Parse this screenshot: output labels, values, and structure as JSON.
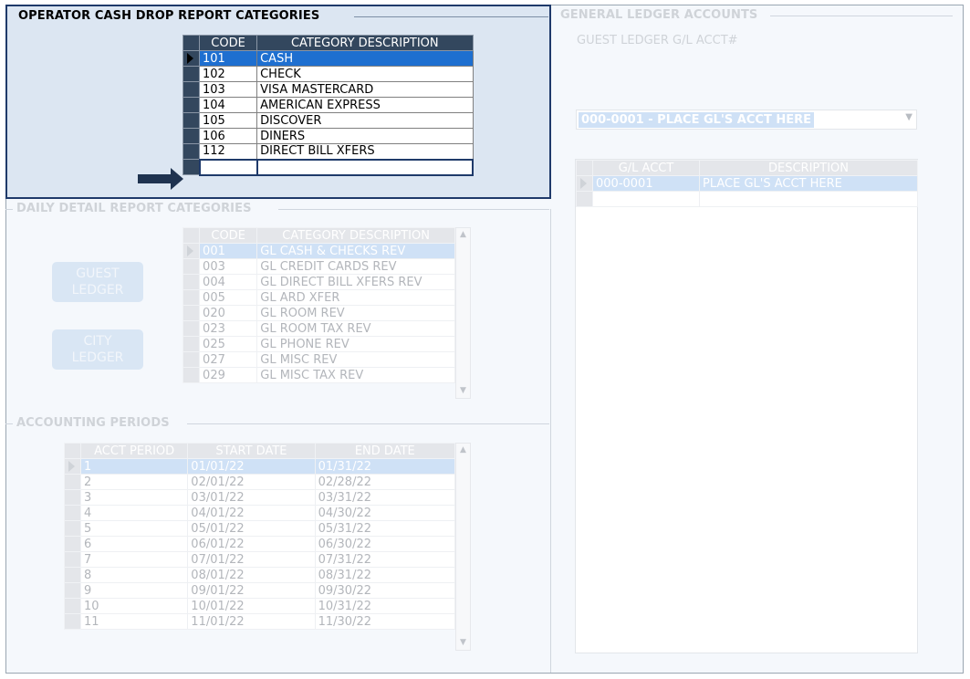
{
  "operator_panel": {
    "title": "OPERATOR CASH DROP REPORT CATEGORIES",
    "columns": [
      "CODE",
      "CATEGORY DESCRIPTION"
    ],
    "rows": [
      {
        "code": "101",
        "desc": "CASH",
        "selected": true
      },
      {
        "code": "102",
        "desc": "CHECK"
      },
      {
        "code": "103",
        "desc": "VISA MASTERCARD"
      },
      {
        "code": "104",
        "desc": "AMERICAN EXPRESS"
      },
      {
        "code": "105",
        "desc": "DISCOVER"
      },
      {
        "code": "106",
        "desc": "DINERS"
      },
      {
        "code": "112",
        "desc": "DIRECT BILL XFERS"
      }
    ]
  },
  "daily_panel": {
    "title": "DAILY DETAIL REPORT CATEGORIES",
    "columns": [
      "CODE",
      "CATEGORY DESCRIPTION"
    ],
    "rows": [
      {
        "code": "001",
        "desc": "GL CASH & CHECKS REV",
        "selected": true
      },
      {
        "code": "003",
        "desc": "GL CREDIT CARDS REV"
      },
      {
        "code": "004",
        "desc": "GL DIRECT BILL XFERS REV"
      },
      {
        "code": "005",
        "desc": "GL ARD XFER"
      },
      {
        "code": "020",
        "desc": "GL ROOM REV"
      },
      {
        "code": "023",
        "desc": "GL ROOM TAX REV"
      },
      {
        "code": "025",
        "desc": "GL PHONE REV"
      },
      {
        "code": "027",
        "desc": "GL MISC REV"
      },
      {
        "code": "029",
        "desc": "GL MISC TAX REV"
      }
    ],
    "guest_ledger_button": [
      "GUEST",
      "LEDGER"
    ],
    "city_ledger_button": [
      "CITY",
      "LEDGER"
    ]
  },
  "accounting_panel": {
    "title": "ACCOUNTING PERIODS",
    "columns": [
      "ACCT PERIOD",
      "START DATE",
      "END DATE"
    ],
    "rows": [
      {
        "p": "1",
        "s": "01/01/22",
        "e": "01/31/22",
        "selected": true
      },
      {
        "p": "2",
        "s": "02/01/22",
        "e": "02/28/22"
      },
      {
        "p": "3",
        "s": "03/01/22",
        "e": "03/31/22"
      },
      {
        "p": "4",
        "s": "04/01/22",
        "e": "04/30/22"
      },
      {
        "p": "5",
        "s": "05/01/22",
        "e": "05/31/22"
      },
      {
        "p": "6",
        "s": "06/01/22",
        "e": "06/30/22"
      },
      {
        "p": "7",
        "s": "07/01/22",
        "e": "07/31/22"
      },
      {
        "p": "8",
        "s": "08/01/22",
        "e": "08/31/22"
      },
      {
        "p": "9",
        "s": "09/01/22",
        "e": "09/30/22"
      },
      {
        "p": "10",
        "s": "10/01/22",
        "e": "10/31/22"
      },
      {
        "p": "11",
        "s": "11/01/22",
        "e": "11/30/22"
      }
    ]
  },
  "gl_panel": {
    "title": "GENERAL LEDGER ACCOUNTS",
    "subtitle": "GUEST LEDGER G/L ACCT#",
    "combo_value": "000-0001 - PLACE GL'S ACCT HERE",
    "columns": [
      "G/L ACCT",
      "DESCRIPTION"
    ],
    "rows": [
      {
        "acct": "000-0001",
        "desc": "PLACE GL'S ACCT HERE",
        "selected": true
      }
    ]
  },
  "icons": {
    "row_indicator": "triangle-right-icon",
    "pointer": "arrow-right-icon",
    "scroll_up": "chevron-up-icon",
    "scroll_down": "chevron-down-icon",
    "combo_dropdown": "chevron-down-icon"
  },
  "colors": {
    "active_border": "#1f3a6a",
    "active_bg": "#dce6f2",
    "header_dark": "#33475e",
    "selection": "#1e6fd0",
    "faded_text": "#d0d3d8"
  }
}
